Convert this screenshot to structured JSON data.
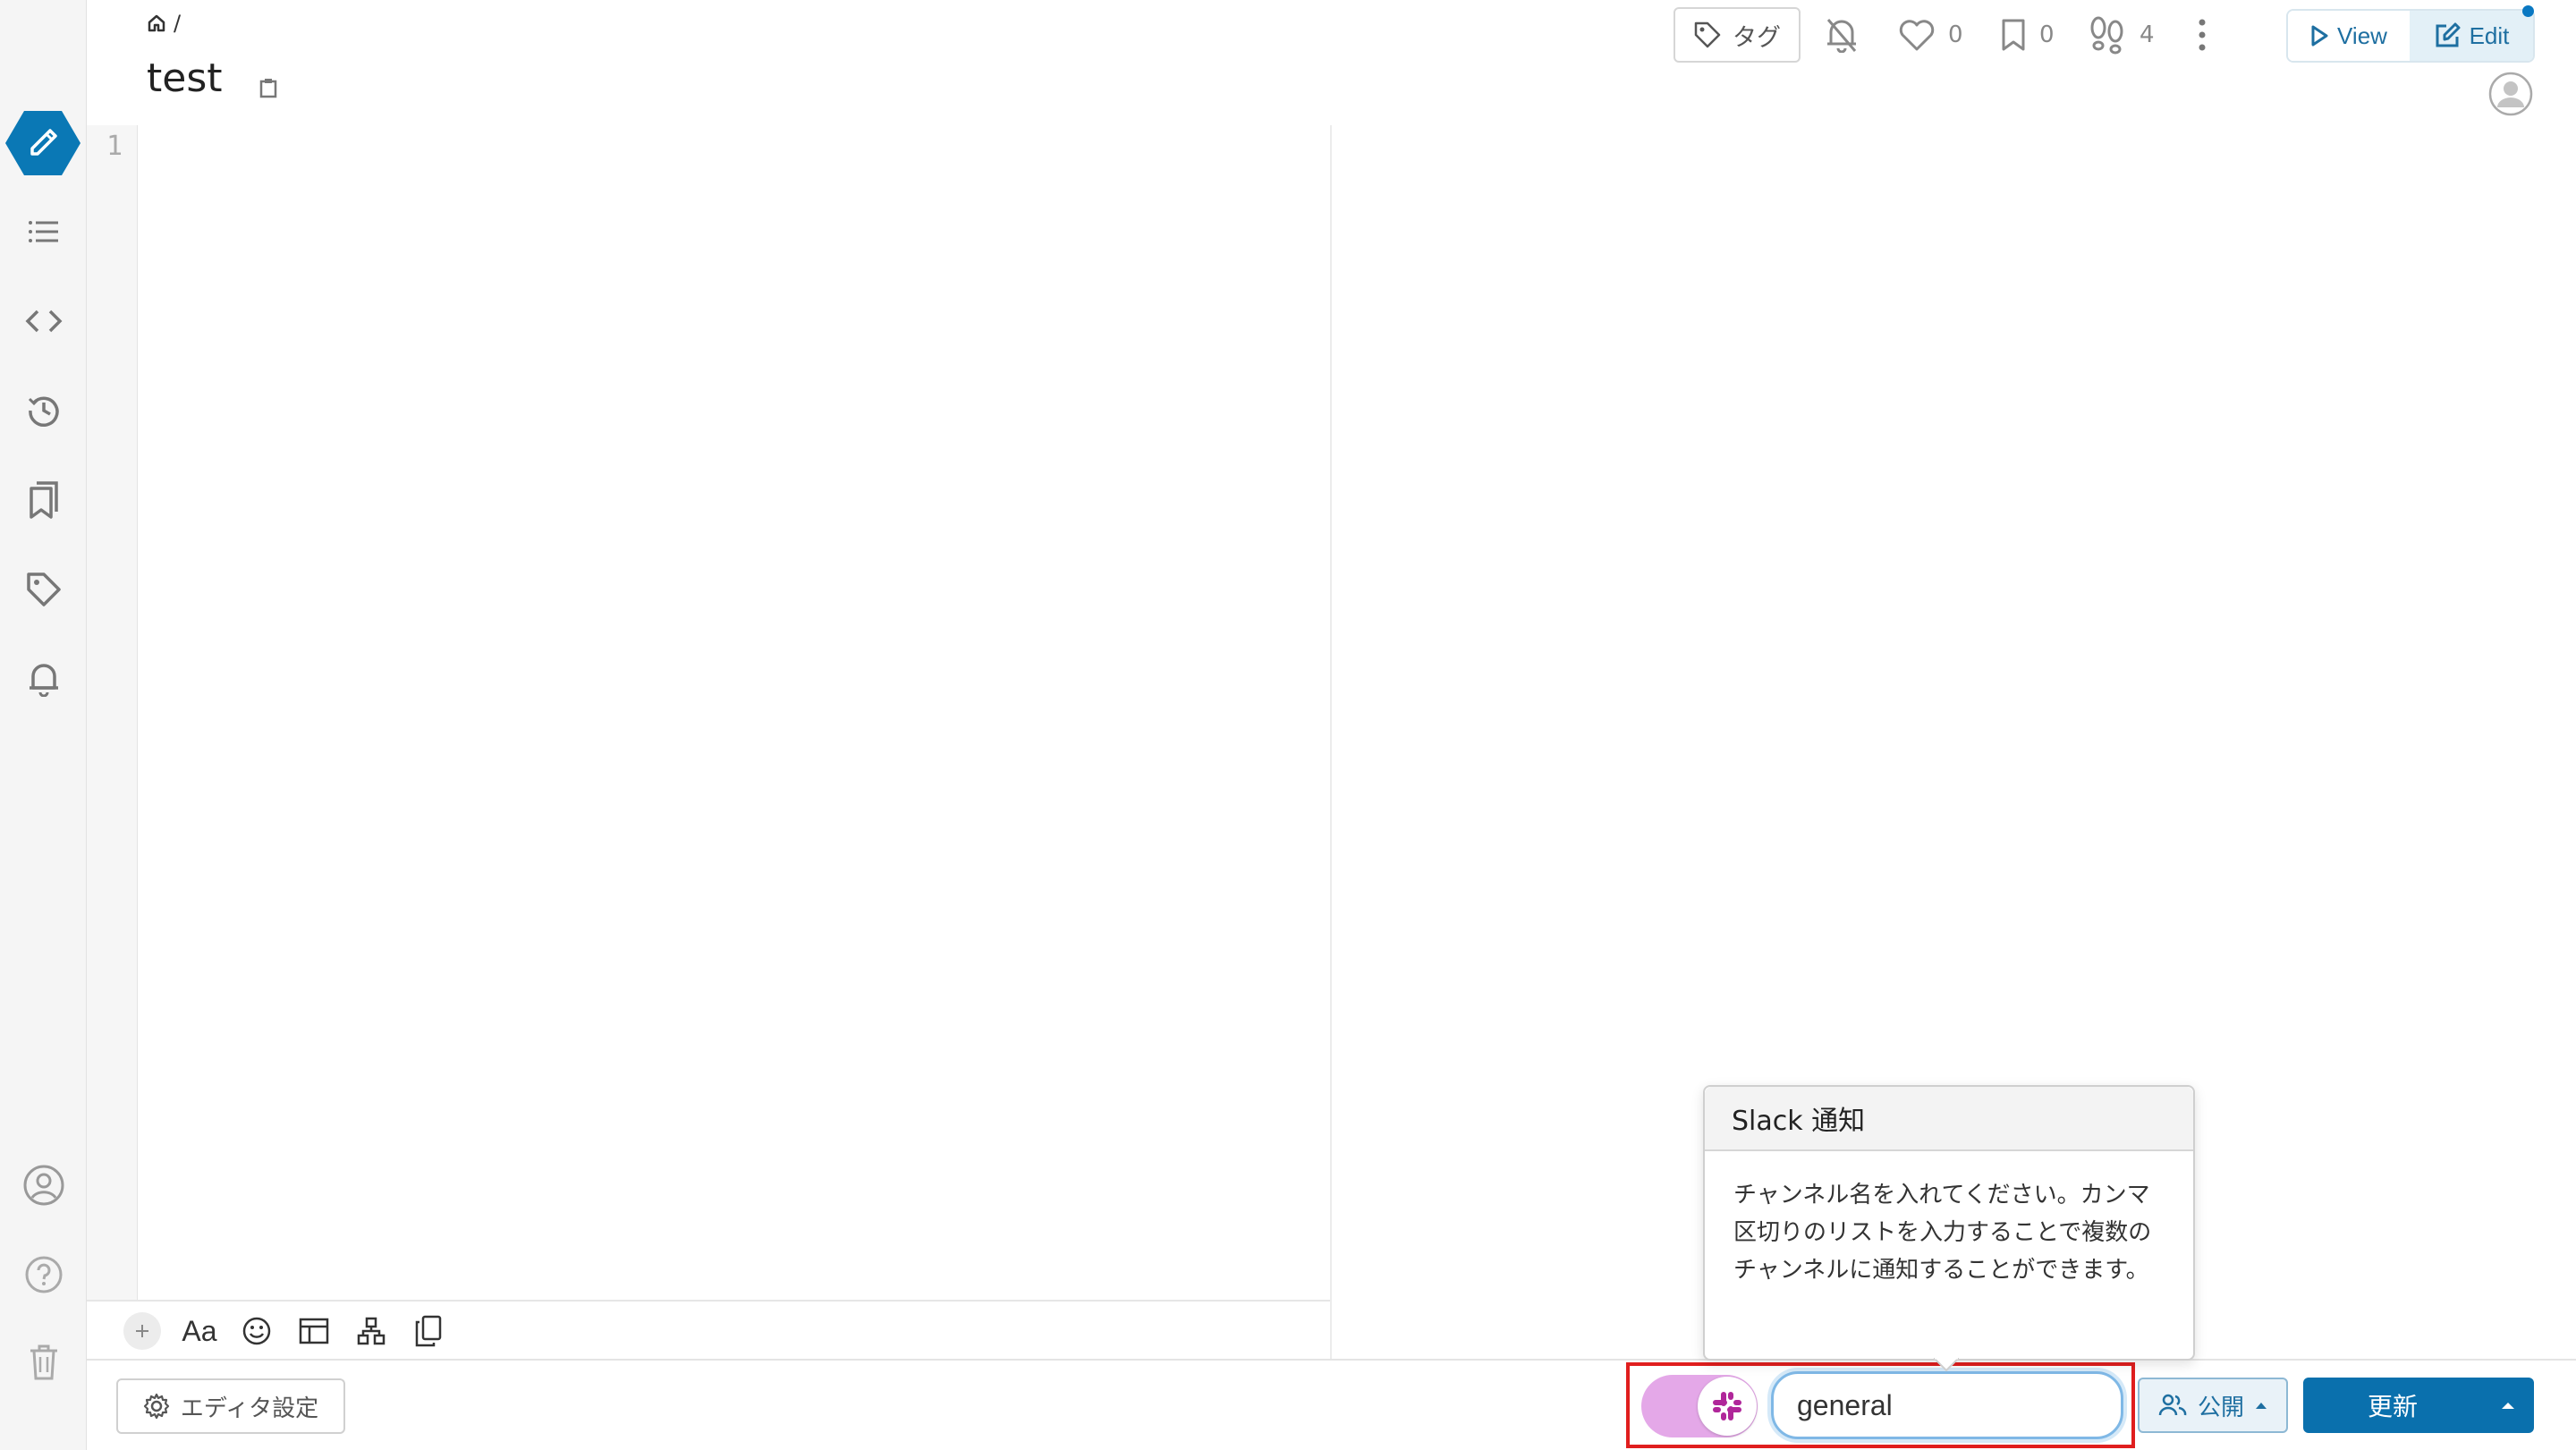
{
  "breadcrumb": {
    "separator": "/"
  },
  "page": {
    "title": "test"
  },
  "header": {
    "tag_label": "タグ",
    "like_count": "0",
    "bookmark_count": "0",
    "seen_count": "4",
    "view_label": "View",
    "edit_label": "Edit"
  },
  "editor": {
    "line_number": "1",
    "toolbar_font_label": "Aa"
  },
  "footer": {
    "editor_settings_label": "エディタ設定",
    "slack_channel_value": "general",
    "visibility_label": "公開",
    "update_label": "更新"
  },
  "popover": {
    "title": "Slack 通知",
    "body": "チャンネル名を入れてください。カンマ区切りのリストを入力することで複数のチャンネルに通知することができます。"
  },
  "colors": {
    "accent": "#0a70ad",
    "slack_toggle": "#e4a8e8",
    "highlight": "#e01e1e"
  }
}
